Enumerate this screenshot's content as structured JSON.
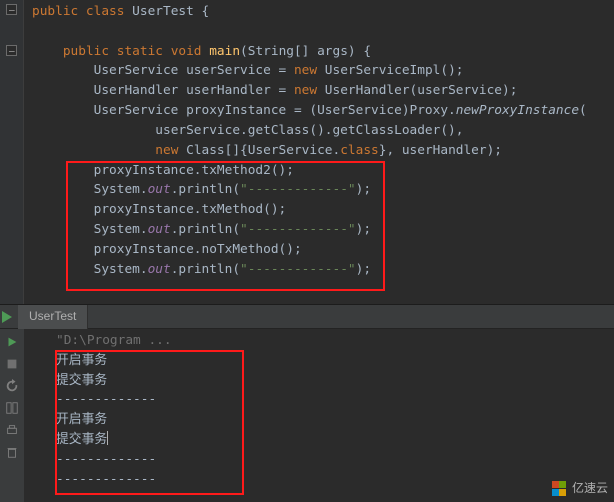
{
  "watermark": "亿速云",
  "run": {
    "tab": "UserTest"
  },
  "code": {
    "l1": {
      "a": "public class ",
      "b": "UserTest {"
    },
    "l3": {
      "a": "public static void ",
      "b": "main",
      "c": "(String[] args) {"
    },
    "l4": {
      "a": "UserService userService = ",
      "b": "new ",
      "c": "UserServiceImpl();"
    },
    "l5": {
      "a": "UserHandler userHandler = ",
      "b": "new ",
      "c": "UserHandler(userService);"
    },
    "l6": {
      "a": "UserService proxyInstance = (UserService)Proxy.",
      "b": "newProxyInstance",
      "c": "("
    },
    "l7": "userService.getClass().getClassLoader(),",
    "l8": {
      "a": "new ",
      "b": "Class[]{UserService.",
      "c": "class",
      "d": "}, userHandler);"
    },
    "l9": "proxyInstance.txMethod2();",
    "l10": {
      "a": "System.",
      "b": "out",
      "c": ".println(",
      "d": "\"-------------\"",
      "e": ");"
    },
    "l11": "proxyInstance.txMethod();",
    "l12": {
      "a": "System.",
      "b": "out",
      "c": ".println(",
      "d": "\"-------------\"",
      "e": ");"
    },
    "l13": "proxyInstance.noTxMethod();",
    "l14": {
      "a": "System.",
      "b": "out",
      "c": ".println(",
      "d": "\"-------------\"",
      "e": ");"
    }
  },
  "out": {
    "l0": "\"D:\\Program ...",
    "l1": "开启事务",
    "l2": "提交事务",
    "l3": "-------------",
    "l4": "开启事务",
    "l5": "提交事务",
    "l6": "-------------",
    "l7": "-------------"
  }
}
